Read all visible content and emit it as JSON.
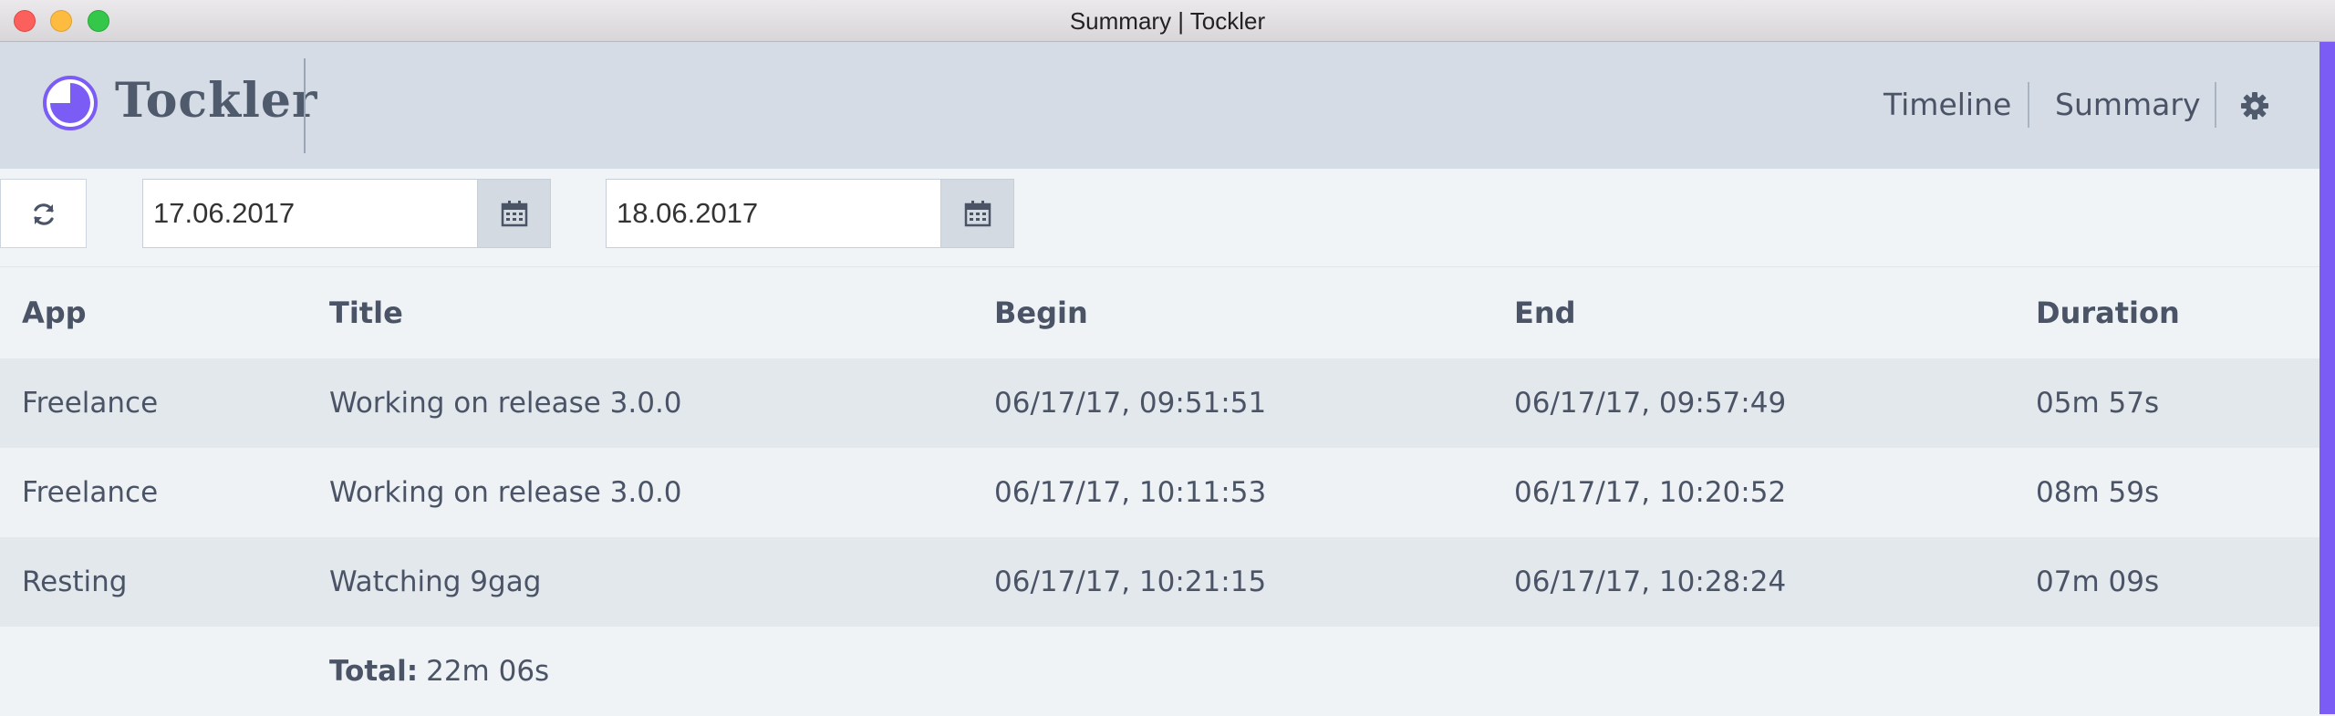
{
  "window": {
    "title": "Summary | Tockler"
  },
  "header": {
    "brand": "Tockler",
    "nav": {
      "timeline": "Timeline",
      "summary": "Summary"
    },
    "settings_icon": "gear-icon",
    "logo_icon": "pie-clock-logo-icon"
  },
  "toolbar": {
    "refresh_icon": "refresh-icon",
    "date_from": "17.06.2017",
    "date_to": "18.06.2017",
    "calendar_icon": "calendar-icon"
  },
  "table": {
    "columns": {
      "app": "App",
      "title": "Title",
      "begin": "Begin",
      "end": "End",
      "duration": "Duration"
    },
    "rows": [
      {
        "app": "Freelance",
        "title": "Working on release 3.0.0",
        "begin": "06/17/17, 09:51:51",
        "end": "06/17/17, 09:57:49",
        "duration": "05m 57s"
      },
      {
        "app": "Freelance",
        "title": "Working on release 3.0.0",
        "begin": "06/17/17, 10:11:53",
        "end": "06/17/17, 10:20:52",
        "duration": "08m 59s"
      },
      {
        "app": "Resting",
        "title": "Watching 9gag",
        "begin": "06/17/17, 10:21:15",
        "end": "06/17/17, 10:28:24",
        "duration": "07m 09s"
      }
    ],
    "total_label": "Total:",
    "total_value": "22m 06s"
  },
  "colors": {
    "accent": "#7b5cf5",
    "header_bg": "#d5dce5",
    "text": "#4a5466"
  }
}
